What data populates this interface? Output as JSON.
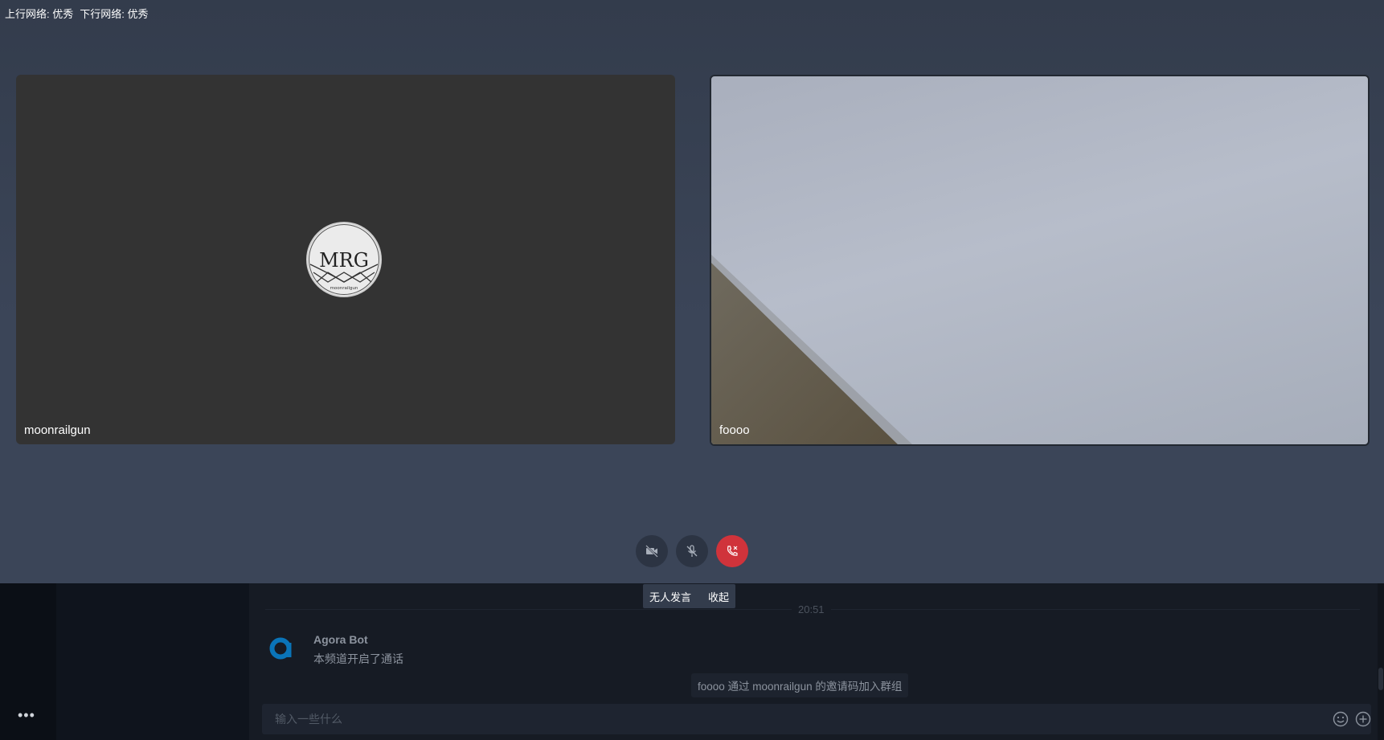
{
  "network": {
    "uplink": "上行网络: 优秀",
    "downlink": "下行网络: 优秀"
  },
  "participants": [
    {
      "name": "moonrailgun",
      "video_on": false,
      "avatar_text": "MRG",
      "avatar_subtext": "moonrailgun"
    },
    {
      "name": "foooo",
      "video_on": true
    }
  ],
  "controls": {
    "camera": "camera-off-icon",
    "mic": "mic-off-icon",
    "hangup": "hangup-icon",
    "hangup_color": "#d0333b"
  },
  "speaker_popup": {
    "status": "无人发言",
    "collapse": "收起"
  },
  "chat": {
    "time": "20:51",
    "messages": [
      {
        "author": "Agora Bot",
        "text": "本频道开启了通话"
      }
    ],
    "system_notice": "foooo 通过 moonrailgun 的邀请码加入群组",
    "input_placeholder": "输入一些什么",
    "more_icon": "more-icon",
    "emoji_icon": "emoji-icon",
    "plus_icon": "plus-icon"
  }
}
